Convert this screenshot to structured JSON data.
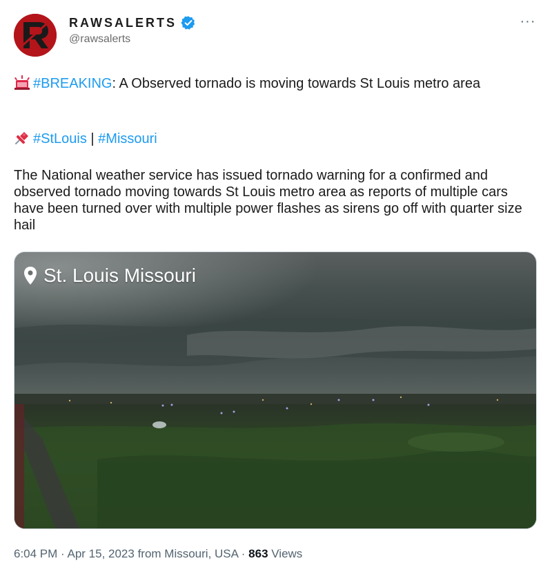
{
  "tweet": {
    "display_name": "RAWSALERTS",
    "handle": "@rawsalerts",
    "avatar_letter": "R",
    "verified": true,
    "more_label": "···",
    "paragraph1": {
      "hashtag": "#BREAKING",
      "text": ": A Observed tornado is moving towards St Louis metro area"
    },
    "paragraph2": {
      "hashtag1": "#StLouis",
      "separator": " | ",
      "hashtag2": "#Missouri"
    },
    "paragraph3": "The National weather service has issued tornado warning for a confirmed and observed tornado moving towards St Louis metro area as reports of multiple cars have been turned over with multiple power flashes as sirens go off with quarter size hail",
    "media": {
      "location_label": "St. Louis Missouri"
    },
    "meta": {
      "time": "6:04 PM",
      "dot1": " · ",
      "date": "Apr 15, 2023",
      "source": " from Missouri, USA",
      "dot2": " · ",
      "views_count": "863",
      "views_label": " Views"
    }
  },
  "colors": {
    "hashtag": "#1d9bf0",
    "verified": "#1d9bf0",
    "avatar_bg": "#b3151b",
    "meta_text": "#536471"
  },
  "icons": [
    "rotating-light-icon",
    "pushpin-icon",
    "location-pin-icon",
    "verified-badge-icon",
    "more-icon"
  ]
}
